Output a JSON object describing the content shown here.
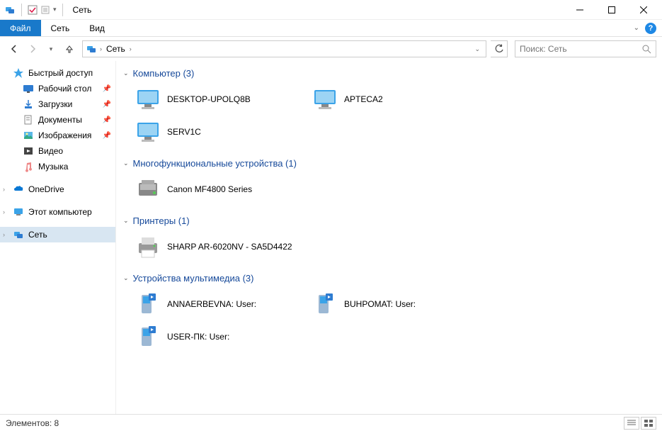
{
  "title": "Сеть",
  "ribbon": {
    "file": "Файл",
    "tabs": [
      "Сеть",
      "Вид"
    ]
  },
  "breadcrumbs": [
    "Сеть"
  ],
  "search_placeholder": "Поиск: Сеть",
  "sidebar": {
    "quick_access": "Быстрый доступ",
    "quick_items": [
      {
        "label": "Рабочий стол",
        "pinned": true
      },
      {
        "label": "Загрузки",
        "pinned": true
      },
      {
        "label": "Документы",
        "pinned": true
      },
      {
        "label": "Изображения",
        "pinned": true
      },
      {
        "label": "Видео",
        "pinned": false
      },
      {
        "label": "Музыка",
        "pinned": false
      }
    ],
    "onedrive": "OneDrive",
    "this_pc": "Этот компьютер",
    "network": "Сеть"
  },
  "groups": [
    {
      "title": "Компьютер",
      "count": 3,
      "type": "computer",
      "items": [
        "DESKTOP-UPOLQ8B",
        "APTECA2",
        "SERV1C"
      ]
    },
    {
      "title": "Многофункциональные устройства",
      "count": 1,
      "type": "mfp",
      "items": [
        "Canon MF4800 Series"
      ]
    },
    {
      "title": "Принтеры",
      "count": 1,
      "type": "printer",
      "items": [
        "SHARP AR-6020NV - SA5D4422"
      ]
    },
    {
      "title": "Устройства мультимедиа",
      "count": 3,
      "type": "media",
      "items": [
        "ANNAERBEVNA: User:",
        "BUHPOMAT: User:",
        "USER-ПК: User:"
      ]
    }
  ],
  "status": "Элементов: 8"
}
